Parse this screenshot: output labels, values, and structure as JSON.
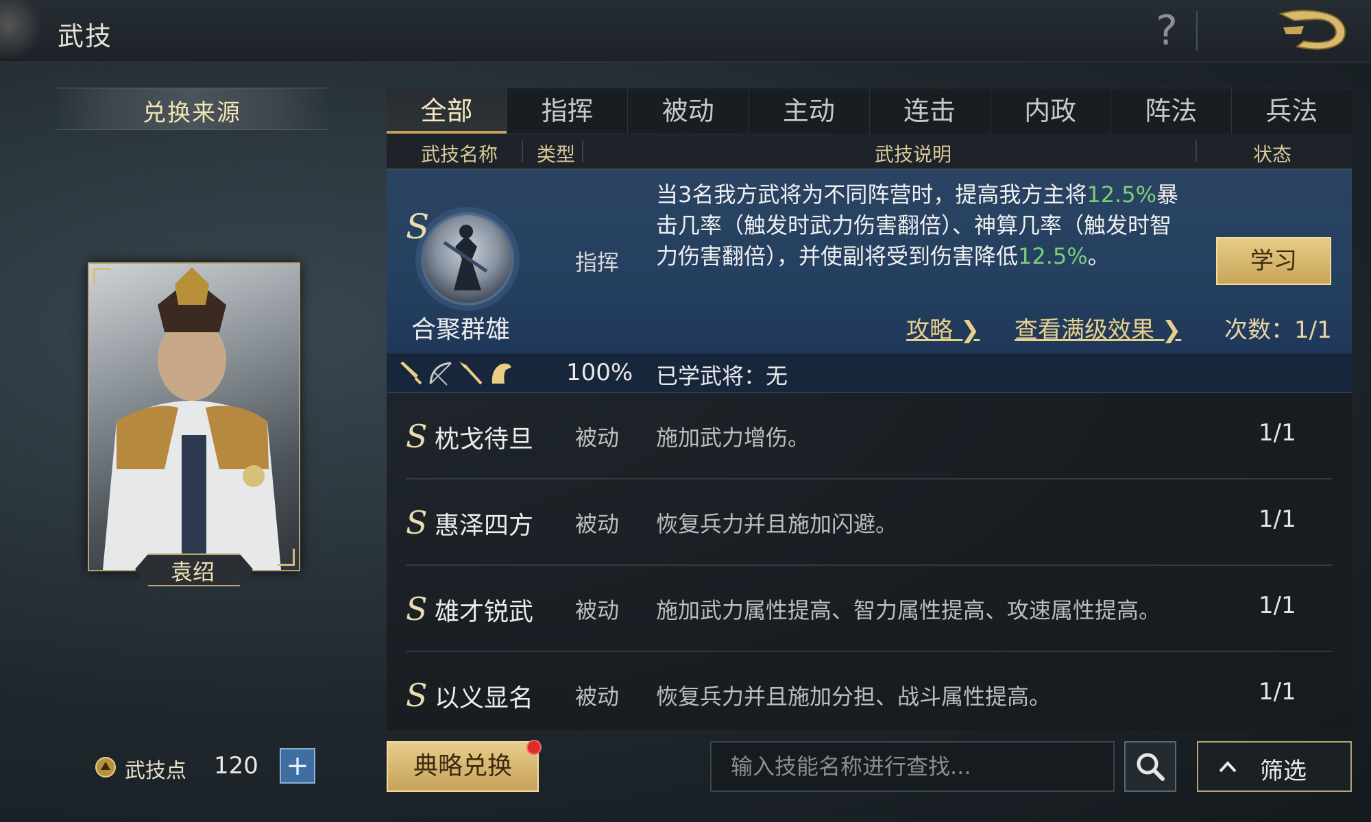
{
  "header": {
    "title": "武技",
    "help_glyph": "?"
  },
  "left_panel": {
    "source_label": "兑换来源",
    "hero_name": "袁绍",
    "points_label": "武技点",
    "points_value": "120"
  },
  "tabs": [
    "全部",
    "指挥",
    "被动",
    "主动",
    "连击",
    "内政",
    "阵法",
    "兵法"
  ],
  "active_tab_index": 0,
  "columns": {
    "name": "武技名称",
    "type": "类型",
    "desc": "武技说明",
    "status": "状态"
  },
  "expanded_skill": {
    "grade": "S",
    "name": "合聚群雄",
    "type": "指挥",
    "desc_1": "当3名我方武将为不同阵营时，提高我方主将",
    "desc_pct1": "12.5%",
    "desc_2": "暴击几率（触发时武力伤害翻倍）、神算几率（触发时智力伤害翻倍），并使副将受到伤害降低",
    "desc_pct2": "12.5%",
    "desc_end": "。",
    "learn_label": "学习",
    "guide_link": "攻略 ❯",
    "full_effect_link": "查看满级效果 ❯",
    "count_label": "次数：1/1",
    "weapon_icons": [
      "sword-icon",
      "bow-icon",
      "spear-icon",
      "horse-icon"
    ],
    "percent": "100%",
    "learned_label": "已学武将：无"
  },
  "skills": [
    {
      "grade": "S",
      "name": "枕戈待旦",
      "type": "被动",
      "desc": "施加武力增伤。",
      "count": "1/1"
    },
    {
      "grade": "S",
      "name": "惠泽四方",
      "type": "被动",
      "desc": "恢复兵力并且施加闪避。",
      "count": "1/1"
    },
    {
      "grade": "S",
      "name": "雄才锐武",
      "type": "被动",
      "desc": "施加武力属性提高、智力属性提高、攻速属性提高。",
      "count": "1/1"
    },
    {
      "grade": "S",
      "name": "以义显名",
      "type": "被动",
      "desc": "恢复兵力并且施加分担、战斗属性提高。",
      "count": "1/1"
    }
  ],
  "bottom": {
    "exchange_label": "典略兑换",
    "search_placeholder": "输入技能名称进行查找...",
    "filter_label": "筛选"
  },
  "colors": {
    "accent_gold": "#c4a15a",
    "highlight_green": "#7ccf7a",
    "expanded_bg": "#24405f"
  }
}
